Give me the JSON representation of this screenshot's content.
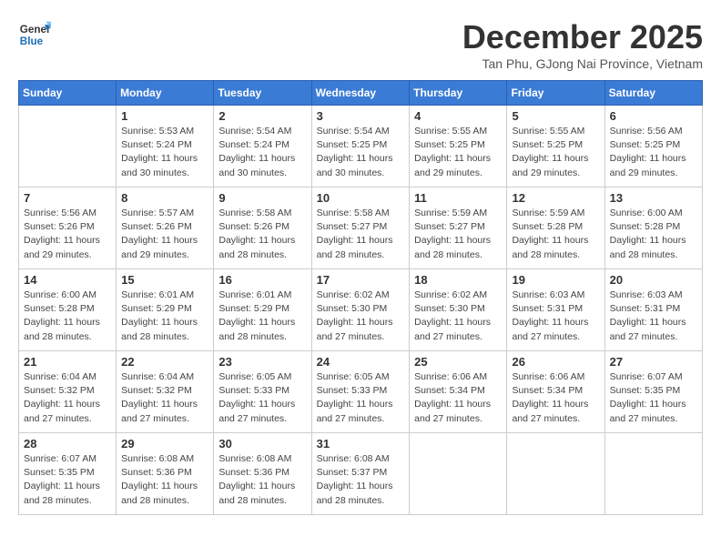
{
  "header": {
    "logo_line1": "General",
    "logo_line2": "Blue",
    "month_title": "December 2025",
    "location": "Tan Phu, GJong Nai Province, Vietnam"
  },
  "days_of_week": [
    "Sunday",
    "Monday",
    "Tuesday",
    "Wednesday",
    "Thursday",
    "Friday",
    "Saturday"
  ],
  "weeks": [
    [
      {
        "num": "",
        "sunrise": "",
        "sunset": "",
        "daylight": "",
        "empty": true
      },
      {
        "num": "1",
        "sunrise": "Sunrise: 5:53 AM",
        "sunset": "Sunset: 5:24 PM",
        "daylight": "Daylight: 11 hours and 30 minutes."
      },
      {
        "num": "2",
        "sunrise": "Sunrise: 5:54 AM",
        "sunset": "Sunset: 5:24 PM",
        "daylight": "Daylight: 11 hours and 30 minutes."
      },
      {
        "num": "3",
        "sunrise": "Sunrise: 5:54 AM",
        "sunset": "Sunset: 5:25 PM",
        "daylight": "Daylight: 11 hours and 30 minutes."
      },
      {
        "num": "4",
        "sunrise": "Sunrise: 5:55 AM",
        "sunset": "Sunset: 5:25 PM",
        "daylight": "Daylight: 11 hours and 29 minutes."
      },
      {
        "num": "5",
        "sunrise": "Sunrise: 5:55 AM",
        "sunset": "Sunset: 5:25 PM",
        "daylight": "Daylight: 11 hours and 29 minutes."
      },
      {
        "num": "6",
        "sunrise": "Sunrise: 5:56 AM",
        "sunset": "Sunset: 5:25 PM",
        "daylight": "Daylight: 11 hours and 29 minutes."
      }
    ],
    [
      {
        "num": "7",
        "sunrise": "Sunrise: 5:56 AM",
        "sunset": "Sunset: 5:26 PM",
        "daylight": "Daylight: 11 hours and 29 minutes."
      },
      {
        "num": "8",
        "sunrise": "Sunrise: 5:57 AM",
        "sunset": "Sunset: 5:26 PM",
        "daylight": "Daylight: 11 hours and 29 minutes."
      },
      {
        "num": "9",
        "sunrise": "Sunrise: 5:58 AM",
        "sunset": "Sunset: 5:26 PM",
        "daylight": "Daylight: 11 hours and 28 minutes."
      },
      {
        "num": "10",
        "sunrise": "Sunrise: 5:58 AM",
        "sunset": "Sunset: 5:27 PM",
        "daylight": "Daylight: 11 hours and 28 minutes."
      },
      {
        "num": "11",
        "sunrise": "Sunrise: 5:59 AM",
        "sunset": "Sunset: 5:27 PM",
        "daylight": "Daylight: 11 hours and 28 minutes."
      },
      {
        "num": "12",
        "sunrise": "Sunrise: 5:59 AM",
        "sunset": "Sunset: 5:28 PM",
        "daylight": "Daylight: 11 hours and 28 minutes."
      },
      {
        "num": "13",
        "sunrise": "Sunrise: 6:00 AM",
        "sunset": "Sunset: 5:28 PM",
        "daylight": "Daylight: 11 hours and 28 minutes."
      }
    ],
    [
      {
        "num": "14",
        "sunrise": "Sunrise: 6:00 AM",
        "sunset": "Sunset: 5:28 PM",
        "daylight": "Daylight: 11 hours and 28 minutes."
      },
      {
        "num": "15",
        "sunrise": "Sunrise: 6:01 AM",
        "sunset": "Sunset: 5:29 PM",
        "daylight": "Daylight: 11 hours and 28 minutes."
      },
      {
        "num": "16",
        "sunrise": "Sunrise: 6:01 AM",
        "sunset": "Sunset: 5:29 PM",
        "daylight": "Daylight: 11 hours and 28 minutes."
      },
      {
        "num": "17",
        "sunrise": "Sunrise: 6:02 AM",
        "sunset": "Sunset: 5:30 PM",
        "daylight": "Daylight: 11 hours and 27 minutes."
      },
      {
        "num": "18",
        "sunrise": "Sunrise: 6:02 AM",
        "sunset": "Sunset: 5:30 PM",
        "daylight": "Daylight: 11 hours and 27 minutes."
      },
      {
        "num": "19",
        "sunrise": "Sunrise: 6:03 AM",
        "sunset": "Sunset: 5:31 PM",
        "daylight": "Daylight: 11 hours and 27 minutes."
      },
      {
        "num": "20",
        "sunrise": "Sunrise: 6:03 AM",
        "sunset": "Sunset: 5:31 PM",
        "daylight": "Daylight: 11 hours and 27 minutes."
      }
    ],
    [
      {
        "num": "21",
        "sunrise": "Sunrise: 6:04 AM",
        "sunset": "Sunset: 5:32 PM",
        "daylight": "Daylight: 11 hours and 27 minutes."
      },
      {
        "num": "22",
        "sunrise": "Sunrise: 6:04 AM",
        "sunset": "Sunset: 5:32 PM",
        "daylight": "Daylight: 11 hours and 27 minutes."
      },
      {
        "num": "23",
        "sunrise": "Sunrise: 6:05 AM",
        "sunset": "Sunset: 5:33 PM",
        "daylight": "Daylight: 11 hours and 27 minutes."
      },
      {
        "num": "24",
        "sunrise": "Sunrise: 6:05 AM",
        "sunset": "Sunset: 5:33 PM",
        "daylight": "Daylight: 11 hours and 27 minutes."
      },
      {
        "num": "25",
        "sunrise": "Sunrise: 6:06 AM",
        "sunset": "Sunset: 5:34 PM",
        "daylight": "Daylight: 11 hours and 27 minutes."
      },
      {
        "num": "26",
        "sunrise": "Sunrise: 6:06 AM",
        "sunset": "Sunset: 5:34 PM",
        "daylight": "Daylight: 11 hours and 27 minutes."
      },
      {
        "num": "27",
        "sunrise": "Sunrise: 6:07 AM",
        "sunset": "Sunset: 5:35 PM",
        "daylight": "Daylight: 11 hours and 27 minutes."
      }
    ],
    [
      {
        "num": "28",
        "sunrise": "Sunrise: 6:07 AM",
        "sunset": "Sunset: 5:35 PM",
        "daylight": "Daylight: 11 hours and 28 minutes."
      },
      {
        "num": "29",
        "sunrise": "Sunrise: 6:08 AM",
        "sunset": "Sunset: 5:36 PM",
        "daylight": "Daylight: 11 hours and 28 minutes."
      },
      {
        "num": "30",
        "sunrise": "Sunrise: 6:08 AM",
        "sunset": "Sunset: 5:36 PM",
        "daylight": "Daylight: 11 hours and 28 minutes."
      },
      {
        "num": "31",
        "sunrise": "Sunrise: 6:08 AM",
        "sunset": "Sunset: 5:37 PM",
        "daylight": "Daylight: 11 hours and 28 minutes."
      },
      {
        "num": "",
        "sunrise": "",
        "sunset": "",
        "daylight": "",
        "empty": true
      },
      {
        "num": "",
        "sunrise": "",
        "sunset": "",
        "daylight": "",
        "empty": true
      },
      {
        "num": "",
        "sunrise": "",
        "sunset": "",
        "daylight": "",
        "empty": true
      }
    ]
  ]
}
